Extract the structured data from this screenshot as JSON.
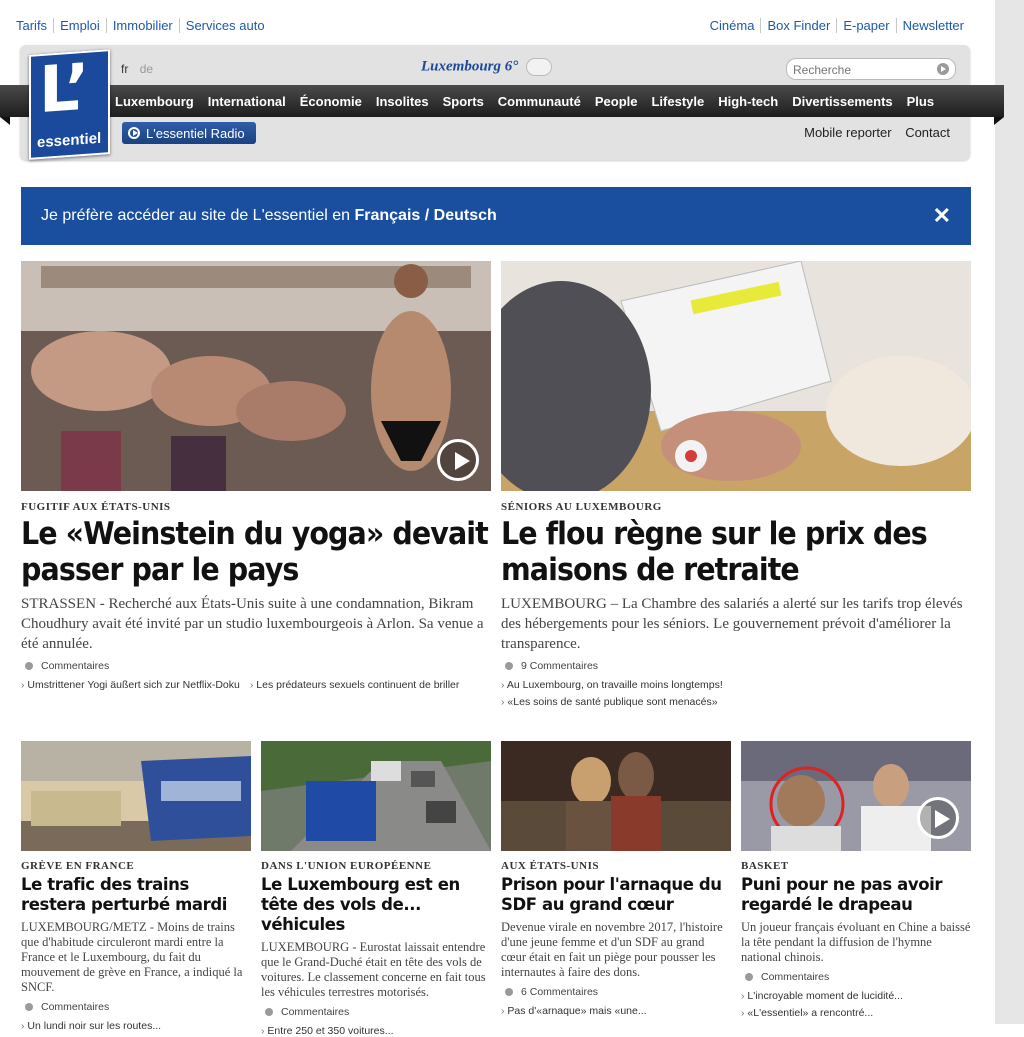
{
  "top_links_left": [
    "Tarifs",
    "Emploi",
    "Immobilier",
    "Services auto"
  ],
  "top_links_right": [
    "Cinéma",
    "Box Finder",
    "E-paper",
    "Newsletter"
  ],
  "logo": {
    "letter": "L’",
    "word": "essentiel"
  },
  "lang": {
    "fr": "fr",
    "de": "de"
  },
  "weather": {
    "text": "Luxembourg 6°",
    "icon": "cloud-sun-icon"
  },
  "search": {
    "placeholder": "Recherche"
  },
  "nav": [
    "Luxembourg",
    "International",
    "Économie",
    "Insolites",
    "Sports",
    "Communauté",
    "People",
    "Lifestyle",
    "High-tech",
    "Divertissements",
    "Plus"
  ],
  "radio_label": "L'essentiel Radio",
  "header_links": [
    "Mobile reporter",
    "Contact"
  ],
  "banner": {
    "prefix": "Je préfère accéder au site de L'essentiel en",
    "fr": "Français",
    "sep": " / ",
    "de": "Deutsch",
    "close": "✕"
  },
  "big_articles": [
    {
      "kicker": "FUGITIF AUX ÉTATS-UNIS",
      "title": "Le «Weinstein du yoga» devait passer par le pays",
      "summary": "STRASSEN - Recherché aux États-Unis suite à une condamnation, Bikram Choudhury avait été invité par un studio luxembourgeois à Arlon. Sa venue a été annulée.",
      "comments": "Commentaires",
      "related": [
        "Umstrittener Yogi äußert sich zur Netflix-Doku",
        "Les prédateurs sexuels continuent de briller"
      ]
    },
    {
      "kicker": "SÉNIORS AU LUXEMBOURG",
      "title": "Le flou règne sur le prix des maisons de retraite",
      "summary": "LUXEMBOURG – La Chambre des salariés a alerté sur les tarifs trop élevés des hébergements pour les séniors. Le gouvernement prévoit d'améliorer la transparence.",
      "comments": "9 Commentaires",
      "related": [
        "Au Luxembourg, on travaille moins longtemps!",
        "«Les soins de santé publique sont menacés»"
      ]
    }
  ],
  "small_articles": [
    {
      "kicker": "GRÈVE EN FRANCE",
      "title": "Le trafic des trains restera perturbé mardi",
      "summary": "LUXEMBOURG/METZ - Moins de trains que d'habitude circuleront mardi entre la France et le Luxembourg, du fait du mouvement de grève en France, a indiqué la SNCF.",
      "comments": "Commentaires",
      "related": [
        "Un lundi noir sur les routes..."
      ]
    },
    {
      "kicker": "DANS L'UNION EUROPÉENNE",
      "title": "Le Luxembourg est en tête des vols de... véhicules",
      "summary": "LUXEMBOURG - Eurostat laissait entendre que le Grand-Duché était en tête des vols de voitures. Le classement concerne en fait tous les véhicules terrestres motorisés.",
      "comments": "Commentaires",
      "related": [
        "Entre 250 et 350 voitures..."
      ]
    },
    {
      "kicker": "AUX ÉTATS-UNIS",
      "title": "Prison pour l'arnaque du SDF au grand cœur",
      "summary": "Devenue virale en novembre 2017, l'histoire d'une jeune femme et d'un SDF au grand cœur était en fait un piège pour pousser les internautes à faire des dons.",
      "comments": "6 Commentaires",
      "related": [
        "Pas d'«arnaque» mais «une..."
      ]
    },
    {
      "kicker": "BASKET",
      "title": "Puni pour ne pas avoir regardé le drapeau",
      "summary": "Un joueur français évoluant en Chine a baissé la tête pendant la diffusion de l'hymne national chinois.",
      "comments": "Commentaires",
      "related": [
        "L'incroyable moment de lucidité...",
        "«L'essentiel» a rencontré..."
      ]
    }
  ],
  "colors": {
    "brand": "#1b4a9c",
    "banner": "#1a4fa0",
    "link": "#1d5aa6"
  }
}
